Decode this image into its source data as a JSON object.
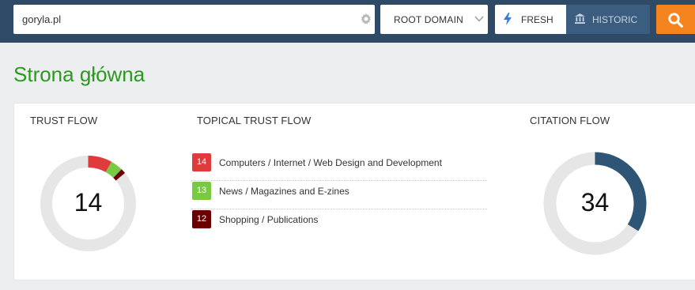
{
  "search": {
    "value": "goryla.pl",
    "settings_icon": "gear-icon"
  },
  "scope": {
    "selected": "ROOT DOMAIN",
    "icon": "chevron-down-icon"
  },
  "index_toggle": {
    "fresh_label": "FRESH",
    "fresh_icon": "lightning-icon",
    "historic_label": "HISTORIC",
    "historic_icon": "bank-icon",
    "active": "fresh"
  },
  "search_button": {
    "icon": "search-icon"
  },
  "page_title": "Strona główna",
  "trust_flow": {
    "title": "TRUST FLOW",
    "value": "14",
    "segments": [
      {
        "value": 14,
        "color": "#e03b3b"
      },
      {
        "value": 13,
        "color": "#7ac943"
      },
      {
        "value": 12,
        "color": "#6b0000"
      }
    ],
    "track_color": "#e6e6e6"
  },
  "topical_trust_flow": {
    "title": "TOPICAL TRUST FLOW",
    "topics": [
      {
        "score": "14",
        "label": "Computers / Internet / Web Design and Development",
        "color": "#e03b3b"
      },
      {
        "score": "13",
        "label": "News / Magazines and E-zines",
        "color": "#7ac943"
      },
      {
        "score": "12",
        "label": "Shopping / Publications",
        "color": "#6b0000"
      }
    ]
  },
  "citation_flow": {
    "title": "CITATION FLOW",
    "value": "34",
    "fill_percent": 34,
    "fill_color": "#2e5575",
    "track_color": "#e6e6e6"
  },
  "colors": {
    "topbar": "#2e4a66",
    "accent": "#f5841f",
    "title_green": "#2a9a1e"
  }
}
